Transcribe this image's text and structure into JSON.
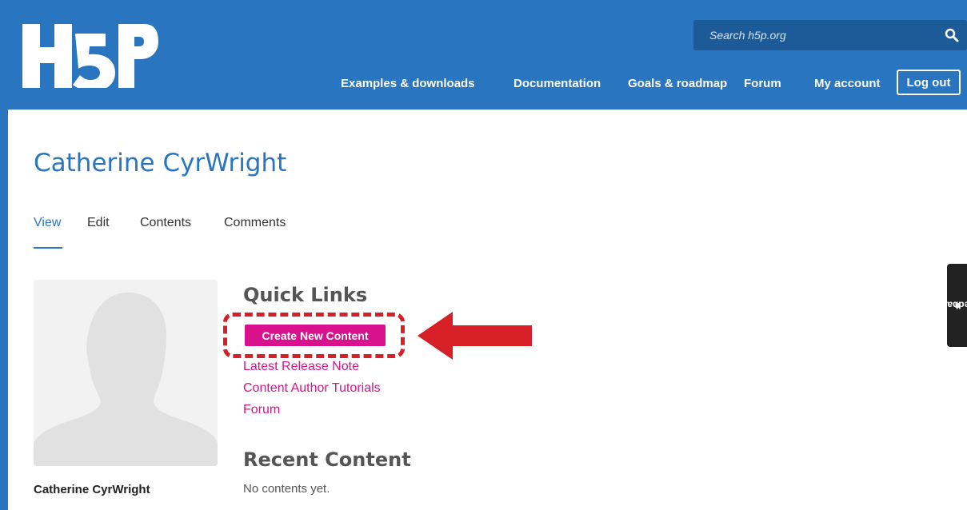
{
  "header": {
    "logo_text": "H5P",
    "search": {
      "placeholder": "Search h5p.org",
      "value": ""
    },
    "nav": [
      {
        "label": "Examples & downloads"
      },
      {
        "label": "Documentation"
      },
      {
        "label": "Goals & roadmap"
      },
      {
        "label": "Forum"
      },
      {
        "label": "My account"
      }
    ],
    "logout_label": "Log out"
  },
  "profile": {
    "name": "Catherine CyrWright",
    "tabs": [
      {
        "label": "View",
        "active": true
      },
      {
        "label": "Edit"
      },
      {
        "label": "Contents"
      },
      {
        "label": "Comments"
      }
    ],
    "username": "Catherine CyrWright"
  },
  "quick_links": {
    "heading": "Quick Links",
    "create_label": "Create New Content",
    "links": [
      {
        "label": "Latest Release Note"
      },
      {
        "label": "Content Author Tutorials"
      },
      {
        "label": "Forum"
      }
    ]
  },
  "recent": {
    "heading": "Recent Content",
    "empty_text": "No contents yet."
  },
  "feedback_label": "feedback",
  "colors": {
    "brand_blue": "#2a75bf",
    "search_bg": "#1d5a98",
    "accent_pink": "#d8128d",
    "annotation_red": "#d61f26"
  }
}
